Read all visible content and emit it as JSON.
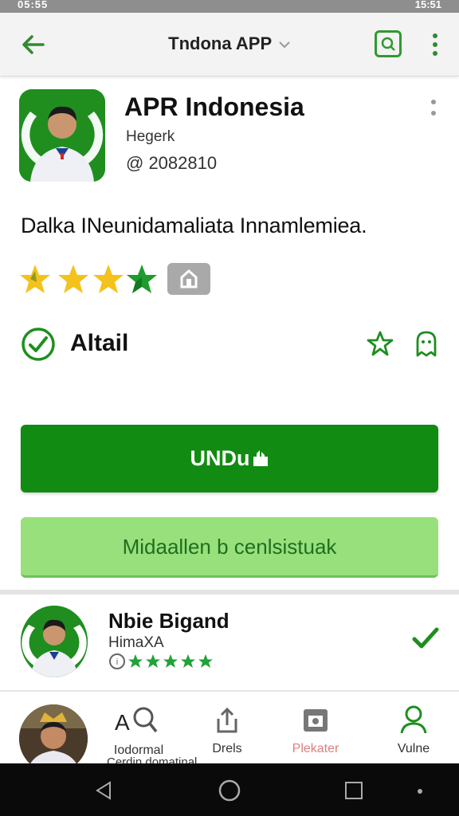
{
  "status_bar": {
    "left_text": "05:55",
    "right_text": "15:51"
  },
  "app_bar": {
    "title": "Tndona APP",
    "back_icon": "arrow-left-icon",
    "action_icon": "search-box-icon",
    "menu_icon": "more-vert-icon"
  },
  "app": {
    "name": "APR Indonesia",
    "developer": "Hegerk",
    "meta": "@ 2082810",
    "description": "Dalka INeunidamaliata Innamlemiea.",
    "rating_stars": 4,
    "feature_label": "Altail"
  },
  "buttons": {
    "install_label": "UNDu",
    "secondary_label": "Midaallen b cenlsistuak"
  },
  "related": {
    "title": "Nbie Bigand",
    "subtitle": "HimaXA",
    "rating_stars": 5
  },
  "bottom_nav": {
    "items": [
      {
        "label": "Iodormal",
        "icon": "search-icon"
      },
      {
        "label": "Drels",
        "icon": "share-icon"
      },
      {
        "label": "Plekater",
        "icon": "camera-icon"
      },
      {
        "label": "Vulne",
        "icon": "user-icon"
      }
    ],
    "clipped_text": "Cerdin domatinal"
  },
  "colors": {
    "brand_green": "#118b11",
    "light_green": "#98e07c",
    "star_yellow": "#f4c21c",
    "icon_green": "#2f9a2f"
  }
}
